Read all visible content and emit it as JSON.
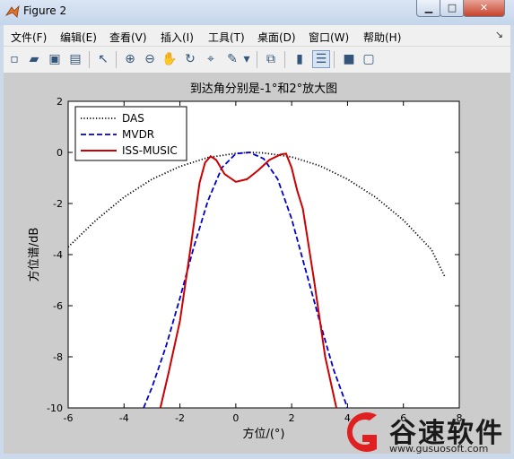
{
  "window": {
    "title": "Figure 2"
  },
  "menu": [
    {
      "label": "文件(F)"
    },
    {
      "label": "编辑(E)"
    },
    {
      "label": "查看(V)"
    },
    {
      "label": "插入(I)"
    },
    {
      "label": "工具(T)"
    },
    {
      "label": "桌面(D)"
    },
    {
      "label": "窗口(W)"
    },
    {
      "label": "帮助(H)"
    }
  ],
  "toolbar": [
    {
      "icon": "new-figure-icon",
      "glyph": "▫"
    },
    {
      "icon": "open-file-icon",
      "glyph": "▰"
    },
    {
      "icon": "save-icon",
      "glyph": "▣"
    },
    {
      "icon": "print-icon",
      "glyph": "▤"
    },
    {
      "icon": "edit-plot-arrow-icon",
      "glyph": "↖"
    },
    {
      "icon": "zoom-in-icon",
      "glyph": "⊕"
    },
    {
      "icon": "zoom-out-icon",
      "glyph": "⊖"
    },
    {
      "icon": "pan-hand-icon",
      "glyph": "✋"
    },
    {
      "icon": "rotate-3d-icon",
      "glyph": "↻"
    },
    {
      "icon": "data-cursor-icon",
      "glyph": "⌖"
    },
    {
      "icon": "brush-icon",
      "glyph": "✎"
    },
    {
      "icon": "brush-dropdown-icon",
      "glyph": "▾"
    },
    {
      "icon": "link-plot-icon",
      "glyph": "⧉"
    },
    {
      "icon": "colorbar-icon",
      "glyph": "▮"
    },
    {
      "icon": "legend-icon",
      "glyph": "☰"
    },
    {
      "icon": "hide-plot-tools-icon",
      "glyph": "■"
    },
    {
      "icon": "show-plot-tools-icon",
      "glyph": "▢"
    }
  ],
  "chart_data": {
    "type": "line",
    "title": "到达角分别是-1°和2°放大图",
    "xlabel": "方位/(°)",
    "ylabel": "方位谱/dB",
    "xlim": [
      -6,
      8
    ],
    "ylim": [
      -10,
      2
    ],
    "xticks": [
      "-6",
      "-4",
      "-2",
      "0",
      "2",
      "4",
      "6",
      "8"
    ],
    "yticks": [
      "2",
      "0",
      "-2",
      "-4",
      "-6",
      "-8",
      "-10"
    ],
    "legend_position": "top-left",
    "grid": false,
    "series": [
      {
        "name": "DAS",
        "style": "dotted",
        "color": "#000000",
        "x": [
          -6,
          -5,
          -4,
          -3,
          -2,
          -1,
          0,
          0.5,
          1,
          2,
          3,
          4,
          5,
          6,
          7,
          7.5
        ],
        "y": [
          -3.7,
          -2.65,
          -1.75,
          -1.05,
          -0.55,
          -0.2,
          -0.04,
          0,
          -0.02,
          -0.18,
          -0.52,
          -1.05,
          -1.75,
          -2.65,
          -3.8,
          -4.9
        ]
      },
      {
        "name": "MVDR",
        "style": "dashed",
        "color": "#0000cc",
        "x": [
          -3.3,
          -3,
          -2.5,
          -2,
          -1.5,
          -1,
          -0.5,
          0,
          0.5,
          1,
          1.5,
          2,
          2.5,
          3,
          3.5,
          4
        ],
        "y": [
          -10,
          -9.2,
          -7.6,
          -5.7,
          -3.7,
          -1.9,
          -0.6,
          -0.05,
          0,
          -0.25,
          -1.05,
          -2.6,
          -4.6,
          -6.6,
          -8.5,
          -10
        ]
      },
      {
        "name": "ISS-MUSIC",
        "style": "solid",
        "color": "#cc0000",
        "x": [
          -2.7,
          -2.4,
          -2,
          -1.6,
          -1.3,
          -1.1,
          -0.9,
          -0.7,
          -0.4,
          0,
          0.4,
          0.8,
          1.2,
          1.6,
          1.8,
          2,
          2.2,
          2.4,
          2.8,
          3.2,
          3.6
        ],
        "y": [
          -10,
          -8.6,
          -6.6,
          -3.6,
          -1.2,
          -0.4,
          -0.15,
          -0.3,
          -0.85,
          -1.15,
          -1.05,
          -0.7,
          -0.3,
          -0.08,
          -0.05,
          -0.6,
          -1.5,
          -2.2,
          -5.0,
          -8.0,
          -10
        ]
      }
    ]
  },
  "watermark": {
    "brand": "谷速软件",
    "url": "www.gusuosoft.com"
  }
}
